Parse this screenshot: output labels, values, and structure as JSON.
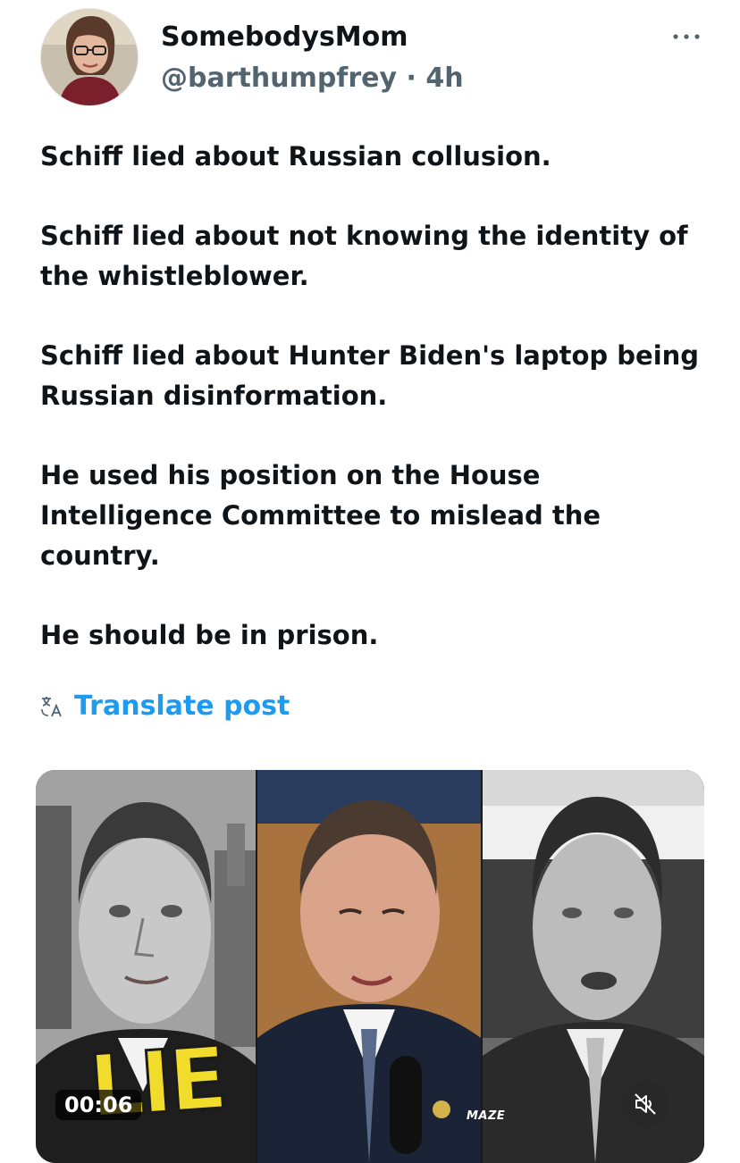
{
  "author": {
    "display_name": "SomebodysMom",
    "handle": "@barthumpfrey",
    "separator": " · ",
    "time_ago": "4h"
  },
  "tweet": {
    "paragraphs": [
      "Schiff lied about Russian collusion.",
      "Schiff lied about not knowing the identity of the whistleblower.",
      "Schiff lied about Hunter Biden's laptop being Russian disinformation.",
      "He used his position on the House Intelligence Committee to mislead the country.",
      "He should be in prison."
    ]
  },
  "translate": {
    "label": "Translate post"
  },
  "media": {
    "duration": "00:06",
    "overlay_text": "LIE",
    "watermark": "MAZE"
  },
  "icons": {
    "more": "more-icon",
    "translate": "translate-icon",
    "mute": "muted-speaker-icon"
  },
  "colors": {
    "text_primary": "#0f1419",
    "text_secondary": "#536471",
    "link": "#1d9bf0",
    "lie_overlay": "#f2dc2b"
  }
}
